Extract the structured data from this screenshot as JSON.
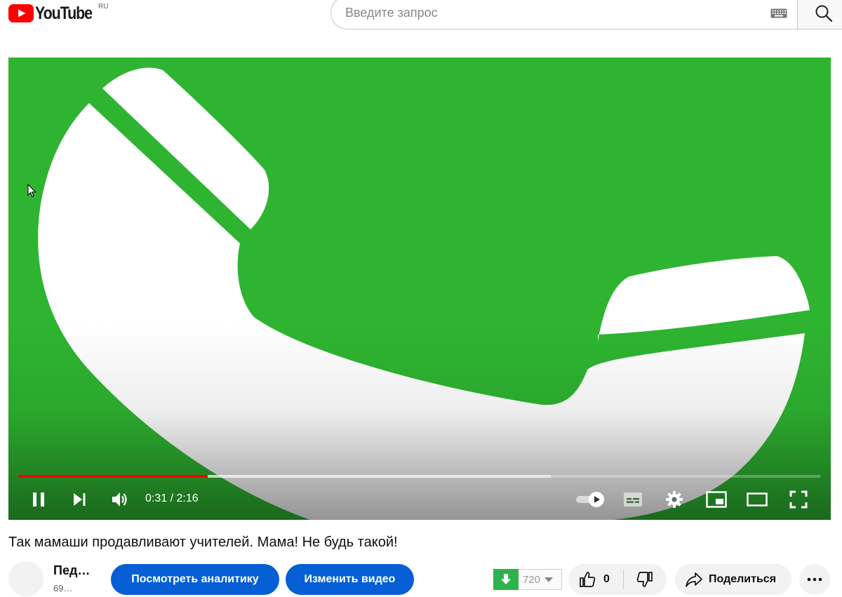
{
  "header": {
    "logo_text": "YouTube",
    "region_code": "RU",
    "search_placeholder": "Введите запрос"
  },
  "player": {
    "time_display": "0:31 / 2:16",
    "progress_played_fraction": 0.236,
    "progress_buffered_fraction": 0.664,
    "colors": {
      "background": "#2eb431",
      "progress_played": "#ff0000"
    }
  },
  "video": {
    "title": "Так мамаши продавливают учителей. Мама! Не будь такой!"
  },
  "channel": {
    "name": "Пед…",
    "subscribers": "69…"
  },
  "actions": {
    "analytics_label": "Посмотреть аналитику",
    "edit_label": "Изменить видео",
    "download_quality": "720",
    "like_count": "0",
    "share_label": "Поделиться"
  },
  "colors": {
    "accent_blue": "#065fd4",
    "logo_red": "#ff0000",
    "download_green": "#2fb24c"
  }
}
